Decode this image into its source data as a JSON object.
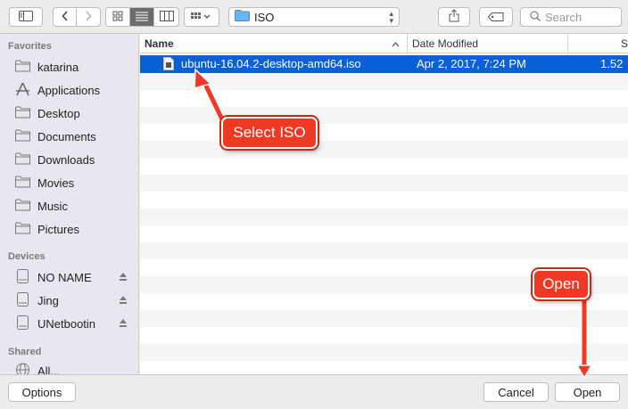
{
  "toolbar": {
    "sidebar_icon": "sidebar-icon",
    "back_icon": "chevron-left-icon",
    "forward_icon": "chevron-right-icon",
    "view_icons": [
      "grid-icon",
      "list-icon",
      "columns-icon"
    ],
    "arrange_icon": "arrange-grid-icon",
    "location": "ISO",
    "share_icon": "share-icon",
    "tag_icon": "tag-icon",
    "search_placeholder": "Search"
  },
  "sidebar": {
    "favorites_title": "Favorites",
    "favorites": [
      {
        "label": "katarina",
        "icon": "folder-icon"
      },
      {
        "label": "Applications",
        "icon": "applications-icon"
      },
      {
        "label": "Desktop",
        "icon": "folder-icon"
      },
      {
        "label": "Documents",
        "icon": "folder-icon"
      },
      {
        "label": "Downloads",
        "icon": "folder-icon"
      },
      {
        "label": "Movies",
        "icon": "folder-icon"
      },
      {
        "label": "Music",
        "icon": "folder-icon"
      },
      {
        "label": "Pictures",
        "icon": "folder-icon"
      }
    ],
    "devices_title": "Devices",
    "devices": [
      {
        "label": "NO NAME",
        "icon": "drive-icon"
      },
      {
        "label": "Jing",
        "icon": "drive-icon"
      },
      {
        "label": "UNetbootin",
        "icon": "drive-icon"
      }
    ],
    "shared_title": "Shared",
    "shared": [
      {
        "label": "All...",
        "icon": "network-icon"
      }
    ]
  },
  "filelist": {
    "columns": [
      "Name",
      "Date Modified",
      "S"
    ],
    "rows": [
      {
        "name": "ubuntu-16.04.2-desktop-amd64.iso",
        "date": "Apr 2, 2017, 7:24 PM",
        "size": "1.52",
        "selected": true
      }
    ]
  },
  "buttons": {
    "options": "Options",
    "cancel": "Cancel",
    "open": "Open"
  },
  "annotations": {
    "select_iso": "Select ISO",
    "open": "Open",
    "color": "#ee3a24"
  }
}
